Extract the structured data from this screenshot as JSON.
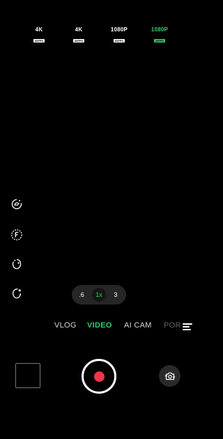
{
  "presets": [
    {
      "res": "4K",
      "fps": "60FPS"
    },
    {
      "res": "4K",
      "fps": "30FPS"
    },
    {
      "res": "1080P",
      "fps": "60FPS"
    },
    {
      "res": "1080P",
      "fps": "30FPS",
      "active": true
    }
  ],
  "side_tools": [
    {
      "icon": "beauty-icon"
    },
    {
      "icon": "filter-icon"
    },
    {
      "icon": "portrait-retouch-icon"
    },
    {
      "icon": "face-enhance-icon"
    }
  ],
  "zoom": {
    "options": [
      ".6",
      "1x",
      "3"
    ],
    "selected": "1x"
  },
  "modes": {
    "items": [
      "VLOG",
      "VIDEO",
      "AI CAM",
      "POR"
    ],
    "selected": "VIDEO"
  },
  "colors": {
    "accent": "#2fd06c",
    "record": "#f0364a"
  },
  "icons": {
    "more_modes": "menu-lines-icon",
    "flip_camera": "camera-flip-icon"
  }
}
